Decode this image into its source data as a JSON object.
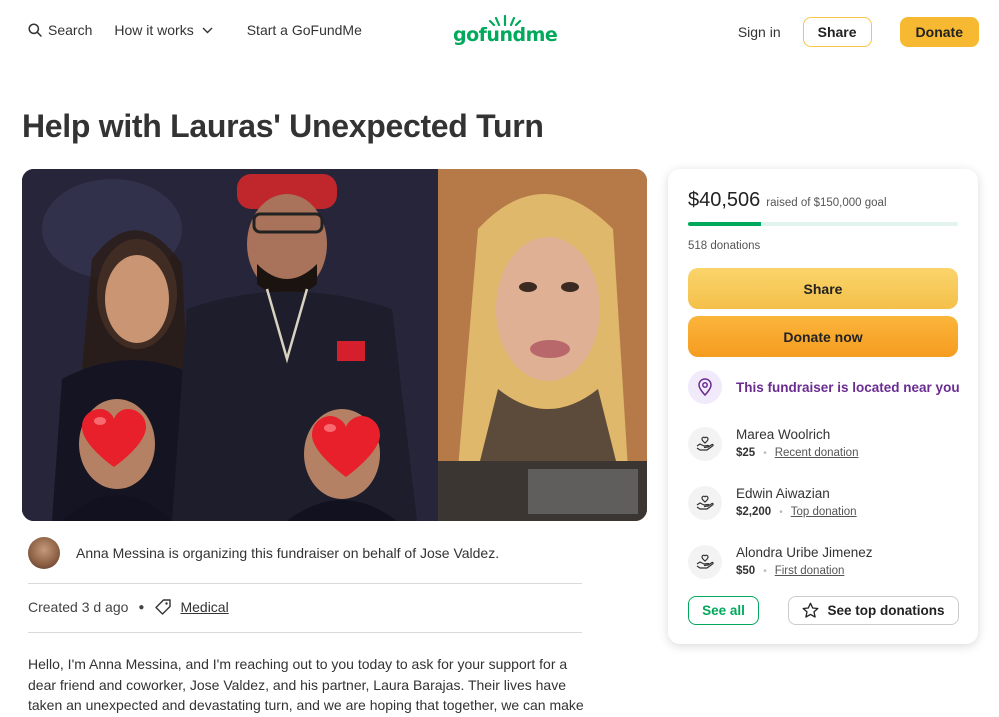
{
  "nav": {
    "search_label": "Search",
    "how_label": "How it works",
    "start_label": "Start a GoFundMe",
    "logo_text": "gofundme",
    "signin_label": "Sign in",
    "share_label": "Share",
    "donate_label": "Donate"
  },
  "campaign": {
    "title": "Help with Lauras' Unexpected Turn",
    "organizer_text": "Anna Messina is organizing this fundraiser on behalf of Jose Valdez.",
    "created": "Created 3 d ago",
    "category": "Medical",
    "story": "Hello, I'm Anna Messina, and I'm reaching out to you today to ask for your support for a dear friend and coworker, Jose Valdez, and his partner, Laura Barajas. Their lives have taken an unexpected and devastating turn, and we are hoping that together, we can make a"
  },
  "card": {
    "raised": "$40,506",
    "goal_text": "raised of $150,000 goal",
    "progress_fraction": 0.27,
    "donations_count": "518 donations",
    "share_label": "Share",
    "donate_label": "Donate now",
    "near_text": "This fundraiser is located near you",
    "donors": [
      {
        "name": "Marea Woolrich",
        "amount": "$25",
        "tag": "Recent donation"
      },
      {
        "name": "Edwin Aiwazian",
        "amount": "$2,200",
        "tag": "Top donation"
      },
      {
        "name": "Alondra Uribe Jimenez",
        "amount": "$50",
        "tag": "First donation"
      }
    ],
    "see_all_label": "See all",
    "see_top_label": "See top donations"
  },
  "colors": {
    "brand_green": "#02a95c",
    "donate_yellow": "#f6b931",
    "donate_orange": "#f59c20",
    "near_purple": "#6b2c91"
  },
  "icons": {
    "search": "search-icon",
    "chevron": "chevron-down-icon",
    "location": "location-pin-icon",
    "donor": "heart-hand-icon",
    "star": "star-icon",
    "tag": "tag-icon"
  }
}
